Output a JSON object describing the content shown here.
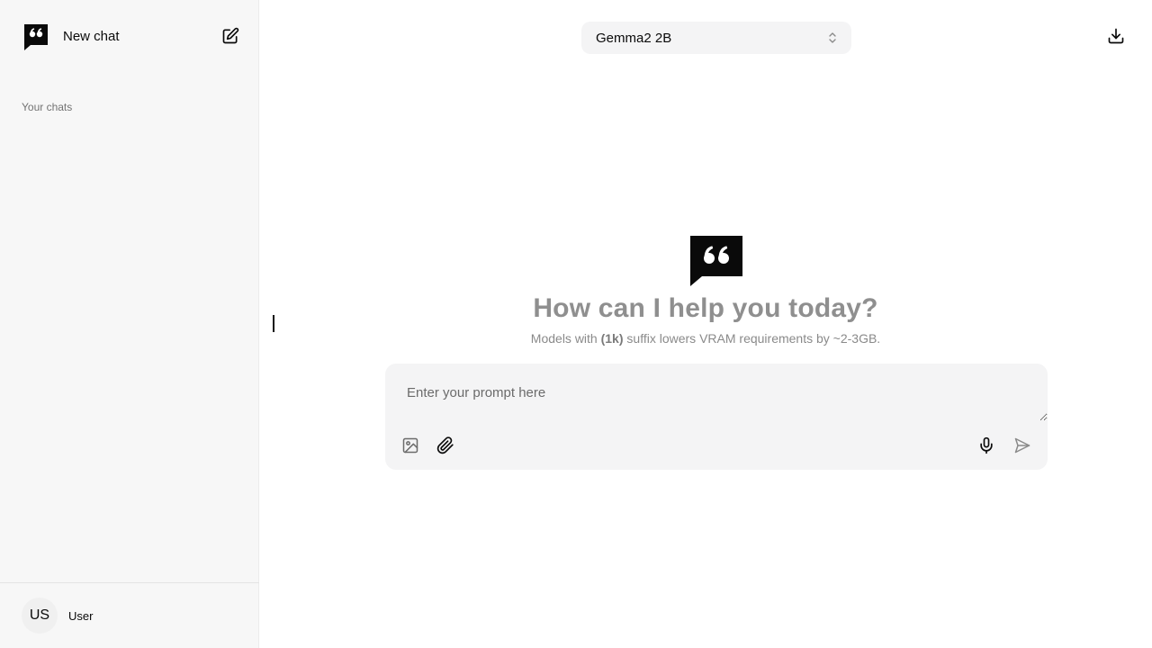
{
  "sidebar": {
    "new_chat_label": "New chat",
    "section_label": "Your chats",
    "user": {
      "initials": "US",
      "name": "User"
    }
  },
  "header": {
    "model": "Gemma2 2B"
  },
  "hero": {
    "title": "How can I help you today?",
    "subtitle_prefix": "Models with ",
    "subtitle_bold": "(1k)",
    "subtitle_suffix": " suffix lowers VRAM requirements by ~2-3GB."
  },
  "composer": {
    "placeholder": "Enter your prompt here",
    "value": ""
  },
  "colors": {
    "sidebar_bg": "#f7f7f7",
    "composer_bg": "#f4f4f5",
    "hero_text": "#8f8f8f"
  },
  "icons": [
    "chat-logo-icon",
    "edit-icon",
    "download-icon",
    "image-icon",
    "paperclip-icon",
    "microphone-icon",
    "send-icon",
    "chevron-updown-icon"
  ]
}
